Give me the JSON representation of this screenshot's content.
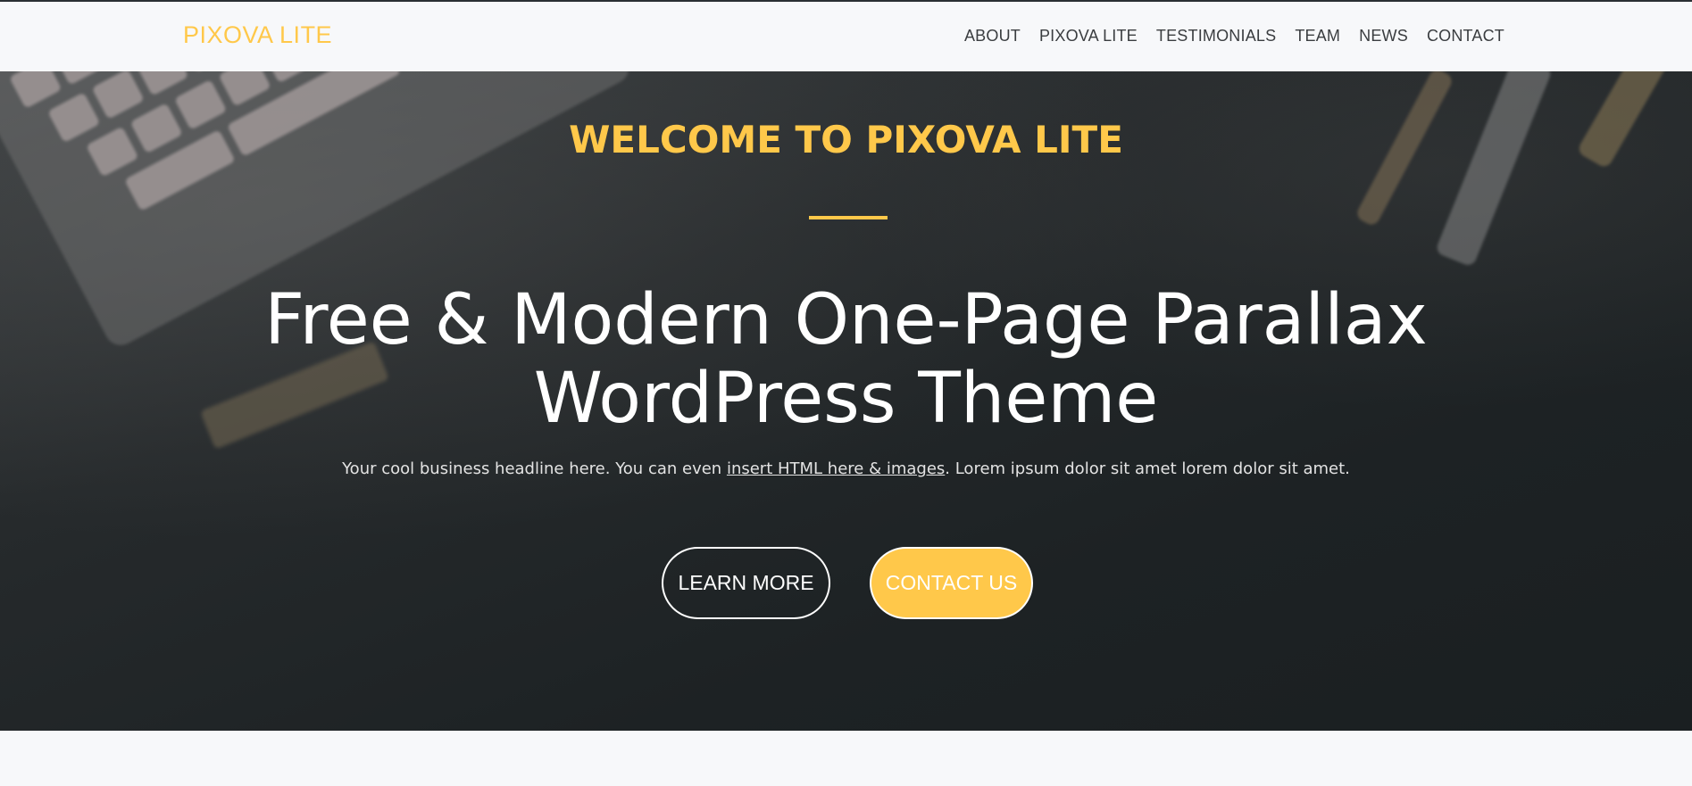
{
  "header": {
    "brand": "PIXOVA LITE",
    "nav": [
      "ABOUT",
      "PIXOVA LITE",
      "TESTIMONIALS",
      "TEAM",
      "NEWS",
      "CONTACT"
    ]
  },
  "hero": {
    "welcome": "WELCOME TO PIXOVA LITE",
    "headline_line1": "Free & Modern One-Page Parallax",
    "headline_line2": "WordPress Theme",
    "subline_before": "Your cool business headline here. You can even ",
    "subline_link": "insert HTML here & images",
    "subline_after": ". Lorem ipsum dolor sit amet lorem dolor sit amet.",
    "learn_more": "LEARN MORE",
    "contact_us": "CONTACT US"
  },
  "colors": {
    "accent": "#ffc84a",
    "hero_bg": "#1f2426",
    "page_bg": "#f7f8fa",
    "nav_text": "#3a3d40"
  }
}
